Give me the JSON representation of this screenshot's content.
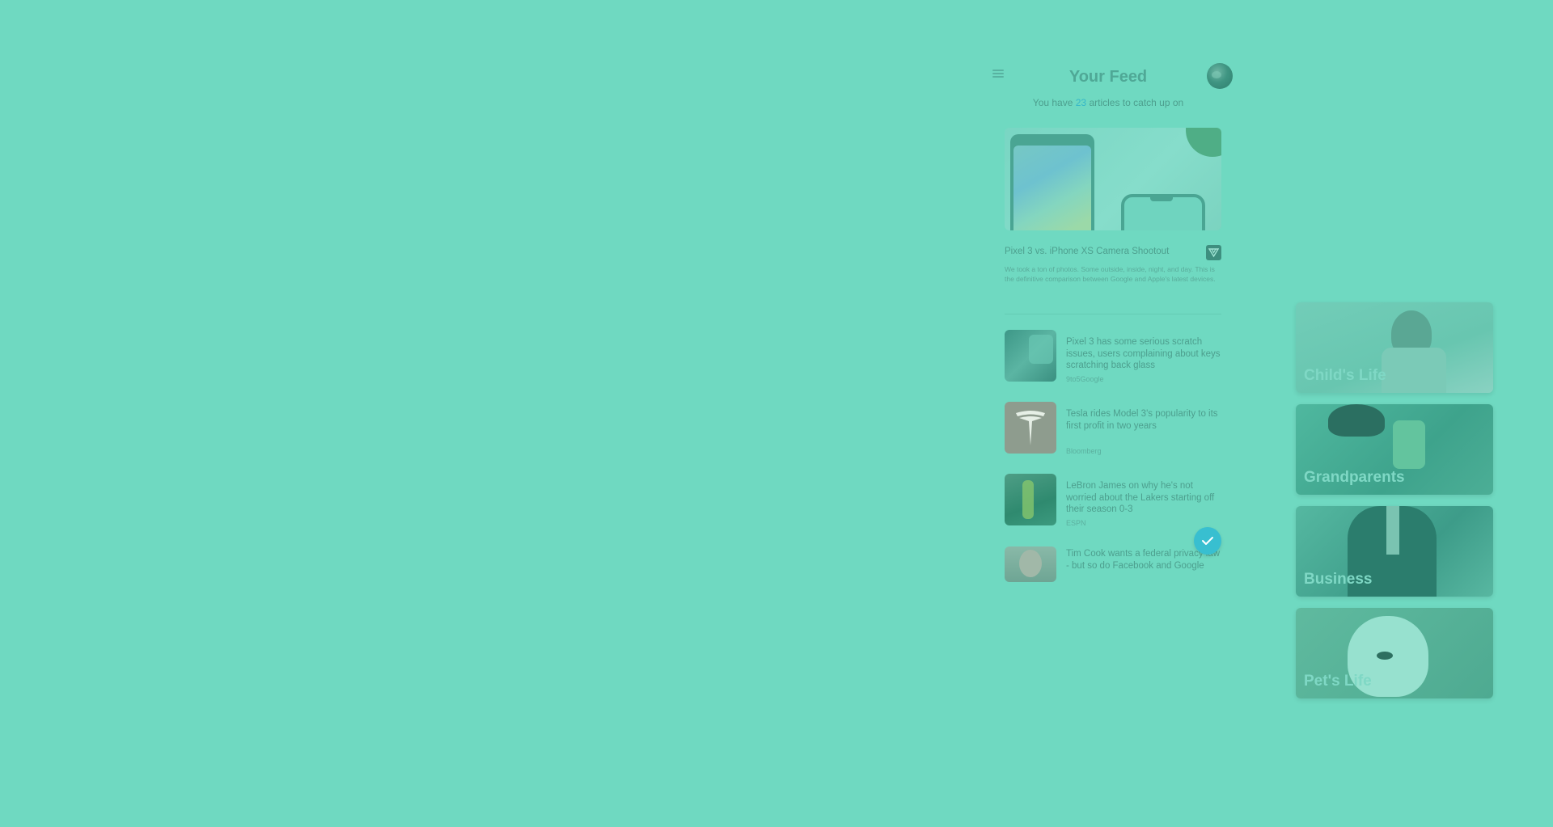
{
  "header": {
    "title": "Your Feed",
    "subtitle_prefix": "You have",
    "article_count": "23",
    "subtitle_suffix": "articles to catch up on"
  },
  "featured": {
    "title": "Pixel 3 vs. iPhone XS Camera Shootout",
    "description": "We took a ton of photos. Some outside, inside, night, and day. This is the definitive comparison between Google and Apple's latest devices."
  },
  "articles": [
    {
      "headline": "Pixel 3 has some serious scratch issues, users complaining about keys scratching back glass",
      "source": "9to5Google"
    },
    {
      "headline": "Tesla rides Model 3's popularity to its first profit in two years",
      "source": "Bloomberg"
    },
    {
      "headline": "LeBron James on why he's not worried about the Lakers starting off their season 0-3",
      "source": "ESPN"
    },
    {
      "headline": "Tim Cook wants a federal privacy law - but so do Facebook and Google",
      "source": ""
    }
  ],
  "categories": [
    {
      "label": "Child's Life"
    },
    {
      "label": "Grandparents"
    },
    {
      "label": "Business"
    },
    {
      "label": "Pet's Life"
    }
  ],
  "colors": {
    "background": "#6fd9c1",
    "accent": "#38bfd0"
  },
  "icons": {
    "menu": "menu-icon",
    "bookmark": "bookmark-icon",
    "check": "check-icon"
  }
}
